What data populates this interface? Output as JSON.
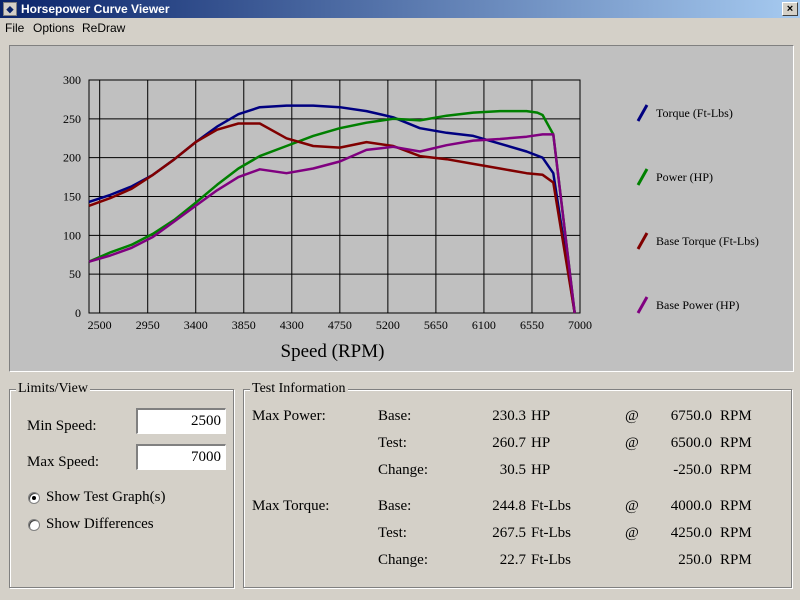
{
  "window": {
    "title": "Horsepower Curve Viewer",
    "close_glyph": "×"
  },
  "menu": [
    "File",
    "Options",
    "ReDraw"
  ],
  "chart_data": {
    "type": "line",
    "xlabel": "Speed (RPM)",
    "ylabel": "",
    "xlim": [
      2400,
      7000
    ],
    "ylim": [
      0,
      300
    ],
    "x_ticks": [
      2500,
      2950,
      3400,
      3850,
      4300,
      4750,
      5200,
      5650,
      6100,
      6550,
      7000
    ],
    "y_ticks": [
      0,
      50,
      100,
      150,
      200,
      250,
      300
    ],
    "grid": true,
    "legend": "right",
    "series": [
      {
        "name": "Torque (Ft-Lbs)",
        "color": "#000080",
        "x": [
          2400,
          2600,
          2800,
          3000,
          3200,
          3400,
          3600,
          3800,
          4000,
          4250,
          4500,
          4750,
          5000,
          5250,
          5500,
          5750,
          6000,
          6250,
          6500,
          6650,
          6750,
          6950
        ],
        "y": [
          143,
          152,
          163,
          178,
          198,
          220,
          240,
          256,
          265,
          267,
          267,
          265,
          260,
          252,
          238,
          232,
          228,
          218,
          208,
          200,
          180,
          0
        ]
      },
      {
        "name": "Power (HP)",
        "color": "#008000",
        "x": [
          2400,
          2600,
          2800,
          3000,
          3200,
          3400,
          3600,
          3800,
          4000,
          4250,
          4500,
          4750,
          5000,
          5250,
          5500,
          5750,
          6000,
          6250,
          6500,
          6600,
          6650,
          6750,
          6950
        ],
        "y": [
          66,
          78,
          88,
          102,
          120,
          142,
          165,
          186,
          202,
          215,
          228,
          238,
          245,
          250,
          248,
          254,
          258,
          260,
          260,
          258,
          255,
          230,
          0
        ]
      },
      {
        "name": "Base Torque (Ft-Lbs)",
        "color": "#800000",
        "x": [
          2400,
          2600,
          2800,
          3000,
          3200,
          3400,
          3600,
          3800,
          4000,
          4250,
          4500,
          4750,
          5000,
          5250,
          5500,
          5750,
          6000,
          6250,
          6500,
          6650,
          6750,
          6950
        ],
        "y": [
          138,
          148,
          160,
          178,
          198,
          220,
          236,
          244,
          244,
          225,
          215,
          213,
          220,
          215,
          202,
          198,
          192,
          186,
          180,
          178,
          168,
          0
        ]
      },
      {
        "name": "Base Power (HP)",
        "color": "#800080",
        "x": [
          2400,
          2600,
          2800,
          3000,
          3200,
          3400,
          3600,
          3800,
          4000,
          4250,
          4500,
          4750,
          5000,
          5250,
          5500,
          5750,
          6000,
          6250,
          6500,
          6650,
          6750,
          6950
        ],
        "y": [
          66,
          74,
          84,
          98,
          118,
          138,
          158,
          175,
          185,
          180,
          186,
          195,
          210,
          214,
          208,
          216,
          222,
          224,
          227,
          230,
          230,
          0
        ]
      }
    ]
  },
  "limits": {
    "title": "Limits/View",
    "min_label": "Min Speed:",
    "min_value": "2500",
    "max_label": "Max Speed:",
    "max_value": "7000",
    "radio_test": "Show Test Graph(s)",
    "radio_diff": "Show Differences",
    "selected": "test"
  },
  "test_info": {
    "title": "Test Information",
    "rows": [
      {
        "group": "Max Power:",
        "label": "Base:",
        "value": "230.3",
        "unit": "HP",
        "at": "@",
        "rpm": "6750.0",
        "rpm_unit": "RPM"
      },
      {
        "group": "",
        "label": "Test:",
        "value": "260.7",
        "unit": "HP",
        "at": "@",
        "rpm": "6500.0",
        "rpm_unit": "RPM"
      },
      {
        "group": "",
        "label": "Change:",
        "value": "30.5",
        "unit": "HP",
        "at": "",
        "rpm": "-250.0",
        "rpm_unit": "RPM"
      },
      {
        "group": "Max Torque:",
        "label": "Base:",
        "value": "244.8",
        "unit": "Ft-Lbs",
        "at": "@",
        "rpm": "4000.0",
        "rpm_unit": "RPM"
      },
      {
        "group": "",
        "label": "Test:",
        "value": "267.5",
        "unit": "Ft-Lbs",
        "at": "@",
        "rpm": "4250.0",
        "rpm_unit": "RPM"
      },
      {
        "group": "",
        "label": "Change:",
        "value": "22.7",
        "unit": "Ft-Lbs",
        "at": "",
        "rpm": "250.0",
        "rpm_unit": "RPM"
      }
    ]
  }
}
